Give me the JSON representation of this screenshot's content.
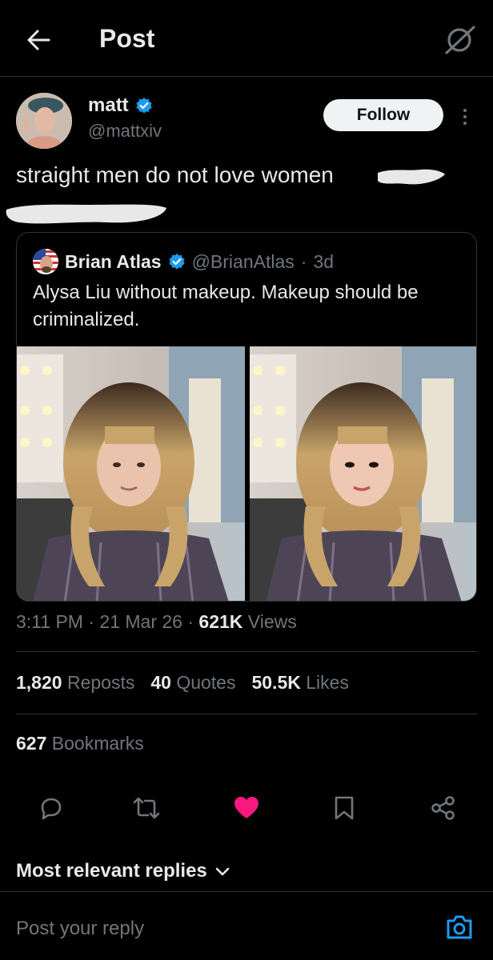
{
  "header": {
    "title": "Post",
    "back_icon": "arrow-left-icon",
    "grok_icon": "grok-icon"
  },
  "post": {
    "author_name": "matt",
    "author_handle": "@mattxiv",
    "verified": true,
    "follow_label": "Follow",
    "text": "straight men do not love women",
    "time": "3:11 PM",
    "date": "21 Mar 26",
    "views_count": "621K",
    "views_label": "Views"
  },
  "quote": {
    "author_name": "Brian Atlas",
    "author_handle": "@BrianAtlas",
    "age": "3d",
    "separator": "·",
    "text": "Alysa Liu without makeup. Makeup should be criminalized."
  },
  "stats": {
    "reposts_count": "1,820",
    "reposts_label": "Reposts",
    "quotes_count": "40",
    "quotes_label": "Quotes",
    "likes_count": "50.5K",
    "likes_label": "Likes",
    "bookmarks_count": "627",
    "bookmarks_label": "Bookmarks"
  },
  "actions": [
    "reply-icon",
    "repost-icon",
    "like-icon",
    "bookmark-icon",
    "share-icon"
  ],
  "replies": {
    "sort_label": "Most relevant replies",
    "placeholder": "Post your reply"
  },
  "colors": {
    "background": "#000000",
    "text": "#e7e9ea",
    "muted": "#71767b",
    "border": "#2f3336",
    "verified_blue": "#1d9bf0",
    "like_pink": "#f91880"
  }
}
